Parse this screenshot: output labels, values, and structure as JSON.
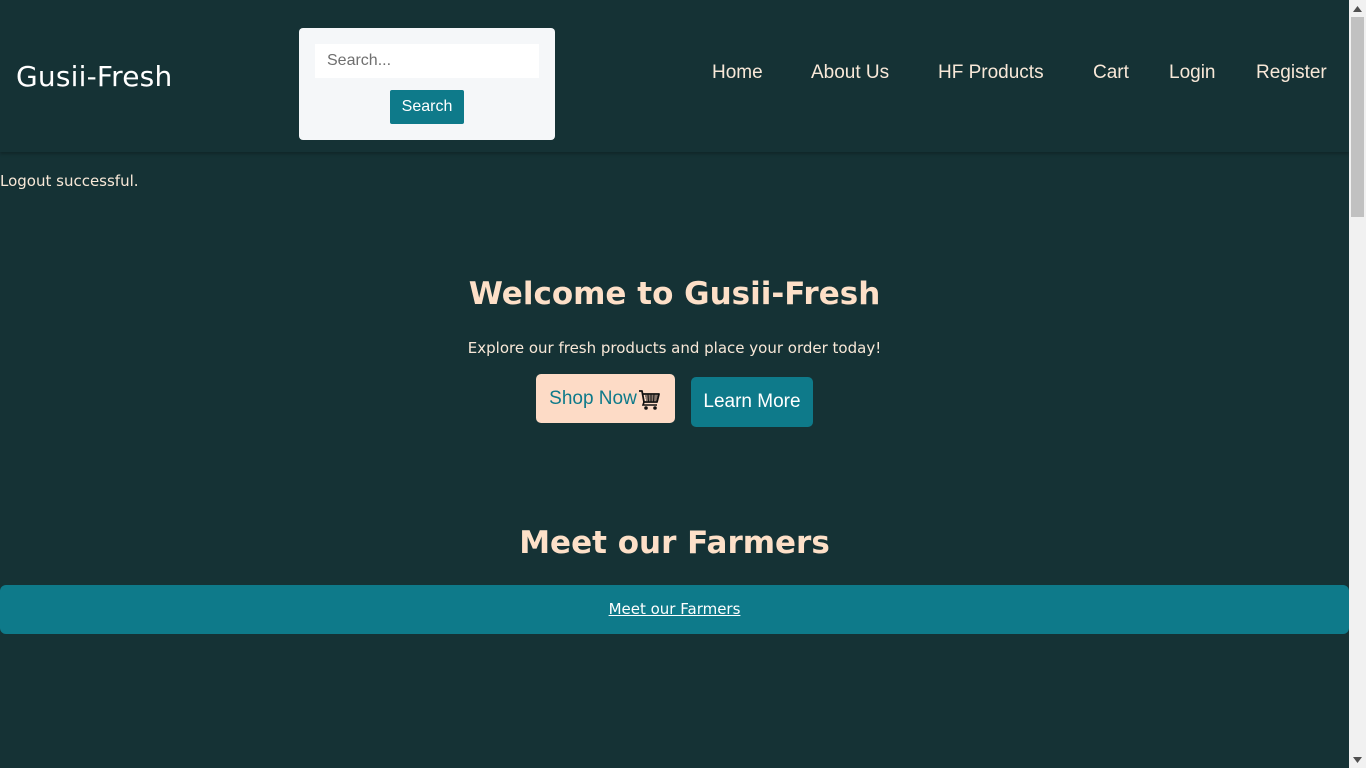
{
  "header": {
    "brand": "Gusii-Fresh",
    "search": {
      "placeholder": "Search...",
      "value": "",
      "button_label": "Search"
    },
    "nav": [
      {
        "label": "Home"
      },
      {
        "label": "About Us"
      },
      {
        "label": "HF Products"
      },
      {
        "label": "Cart"
      },
      {
        "label": "Login"
      },
      {
        "label": "Register"
      }
    ]
  },
  "status": {
    "message": "Logout successful."
  },
  "hero": {
    "title": "Welcome to Gusii-Fresh",
    "subtitle": "Explore our fresh products and place your order today!",
    "shop_button": "Shop Now",
    "shop_icon": "shopping-cart-icon",
    "learn_button": "Learn More"
  },
  "farmers": {
    "title": "Meet our Farmers",
    "link_label": "Meet our Farmers"
  },
  "colors": {
    "background": "#153235",
    "accent_teal": "#0e7a8a",
    "peach": "#fddbc6",
    "heading": "#fde0c8"
  }
}
